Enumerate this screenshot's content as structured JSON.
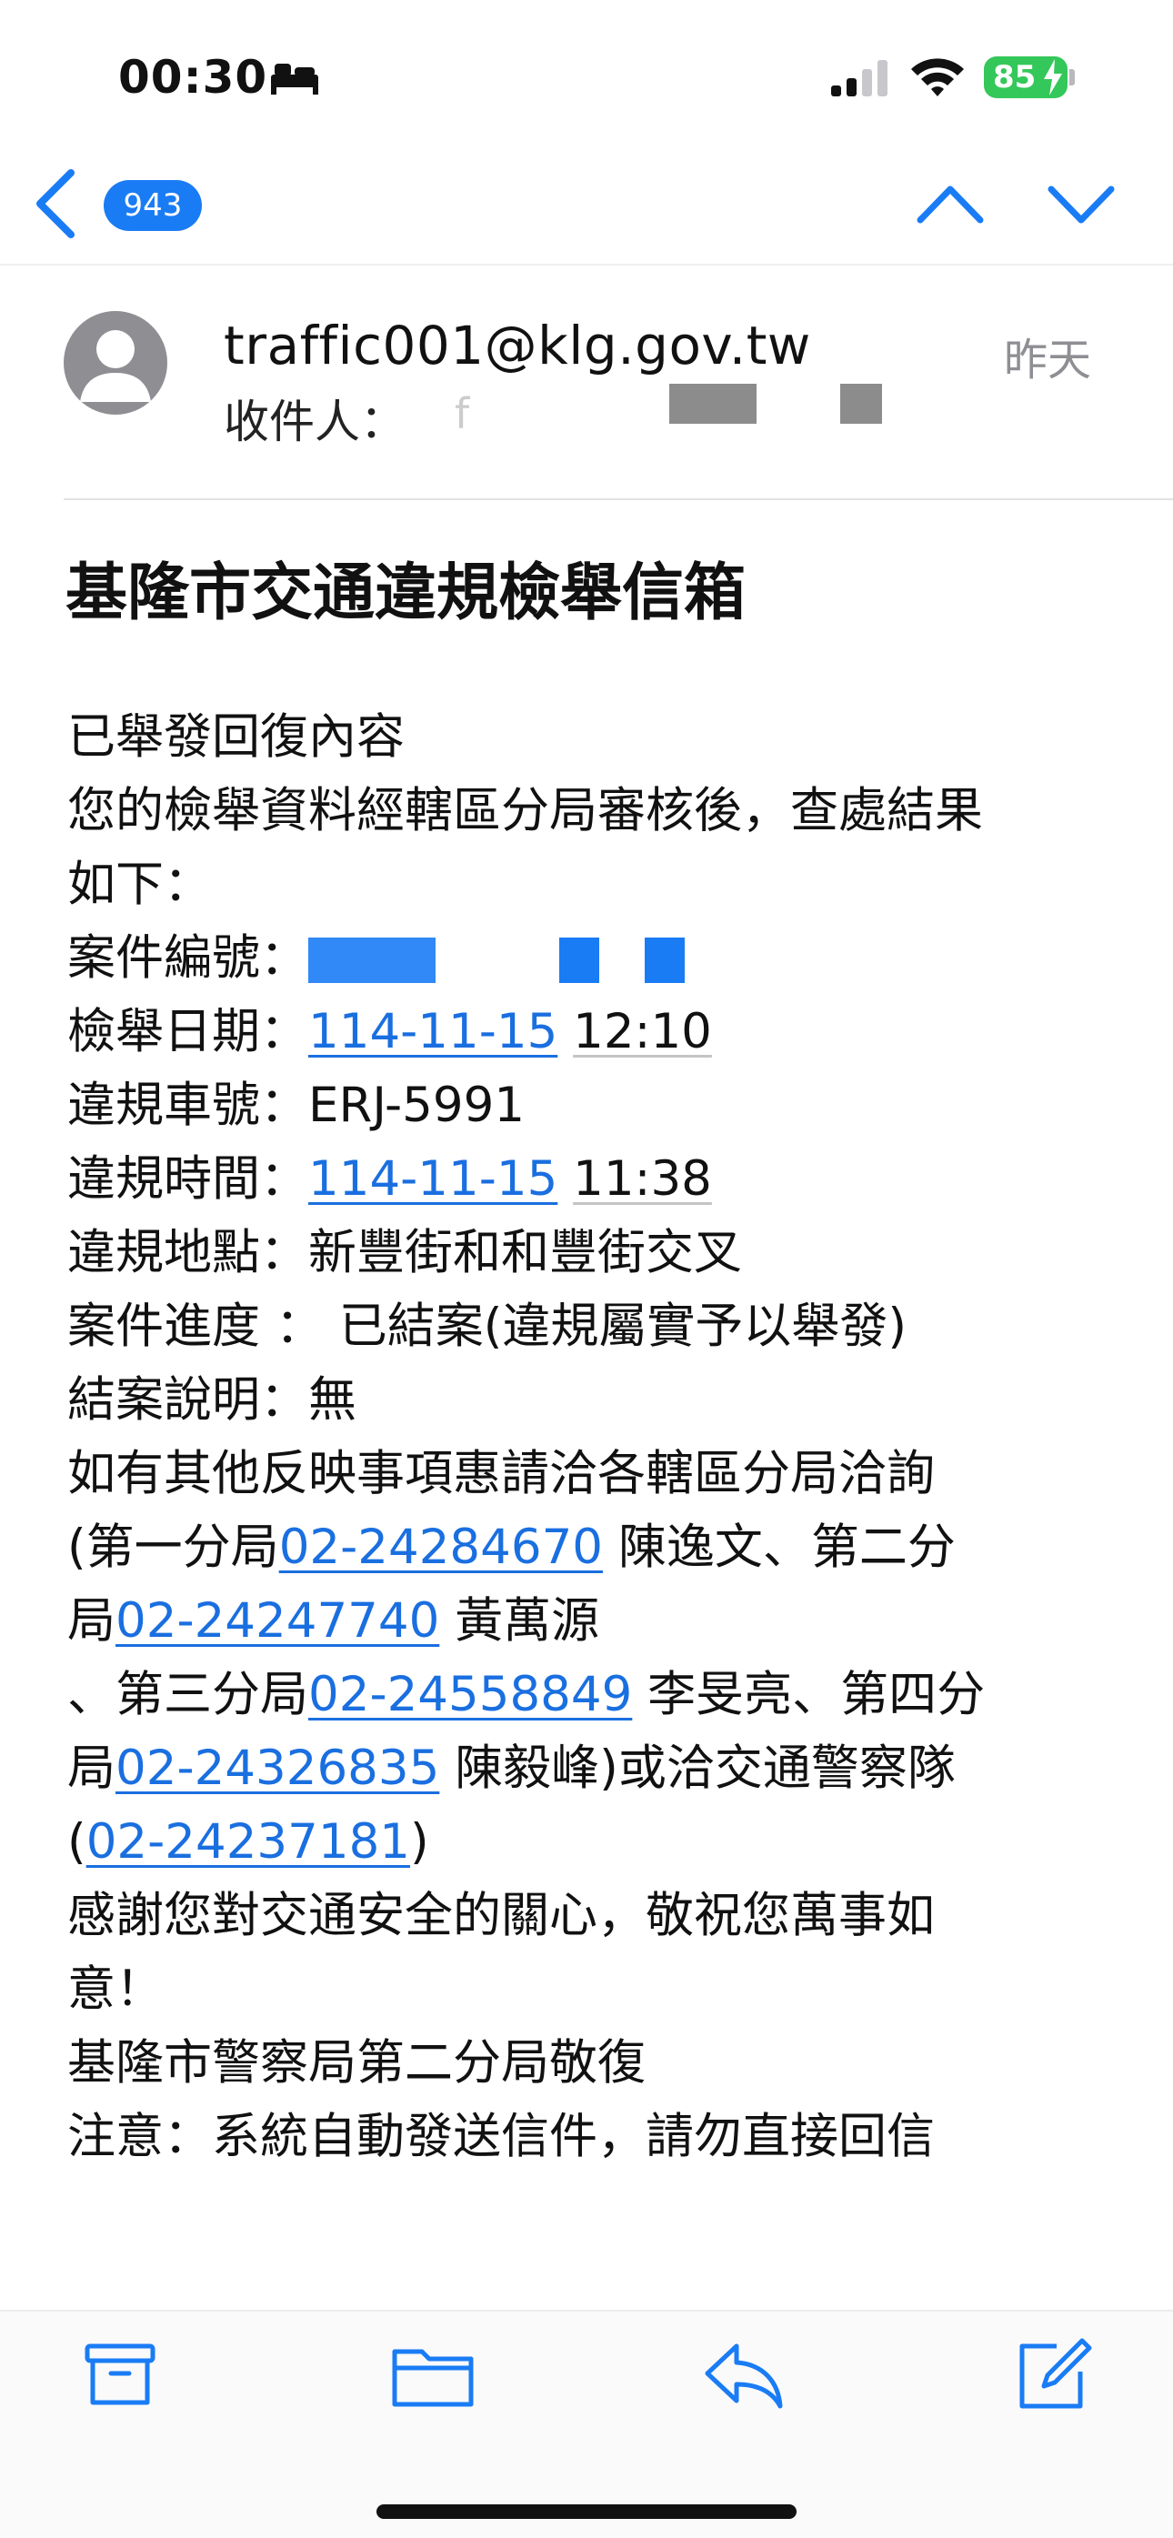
{
  "status_bar": {
    "time": "00:30",
    "battery": "85"
  },
  "nav": {
    "unread_count": "943"
  },
  "email": {
    "sender": "traffic001@klg.gov.tw",
    "date": "昨天",
    "to_label": "收件人：",
    "to_value": "f",
    "subject": "基隆市交通違規檢舉信箱",
    "body": {
      "l1": "已舉發回復內容",
      "l2": "您的檢舉資料經轄區分局審核後，查處結果",
      "l3": "如下：",
      "case_no_label": "案件編號：",
      "report_date_label": "檢舉日期：",
      "report_date": "114-11-15",
      "report_time": "12:10",
      "plate_label": "違規車號：",
      "plate": "ERJ-5991",
      "violation_time_label": "違規時間：",
      "violation_date": "114-11-15",
      "violation_time": "11:38",
      "location_label": "違規地點：",
      "location": "新豐街和和豐街交叉",
      "progress_label": "案件進度 ：",
      "progress": "已結案(違規屬實予以舉發)",
      "closing_label": "結案說明：",
      "closing": "無",
      "contact_l1": "如有其他反映事項惠請洽各轄區分局洽詢",
      "contact_l2_a": "(第一分局",
      "phone_1": "02-24284670",
      "contact_l2_b": " 陳逸文、第二分",
      "contact_l3_a": "局",
      "phone_2": "02-24247740",
      "contact_l3_b": " 黃萬源",
      "contact_l4_a": "、第三分局",
      "phone_3": "02-24558849",
      "contact_l4_b": " 李旻亮、第四分",
      "contact_l5_a": "局",
      "phone_4": "02-24326835",
      "contact_l5_b": " 陳毅峰)或洽交通警察隊",
      "contact_l6_a": "(",
      "phone_5": "02-24237181",
      "contact_l6_b": ")",
      "thanks_l1": "感謝您對交通安全的關心，敬祝您萬事如",
      "thanks_l2": "意！",
      "signature": "基隆市警察局第二分局敬復",
      "notice": "注意：系統自動發送信件，請勿直接回信"
    }
  },
  "colors": {
    "accent": "#1a7cf5",
    "link": "#1a6fe0",
    "battery": "#34c759"
  },
  "icons": [
    "bed-icon",
    "signal-icon",
    "wifi-icon",
    "chevron-left-icon",
    "chevron-up-icon",
    "chevron-down-icon",
    "archive-icon",
    "folder-icon",
    "reply-icon",
    "compose-icon"
  ]
}
